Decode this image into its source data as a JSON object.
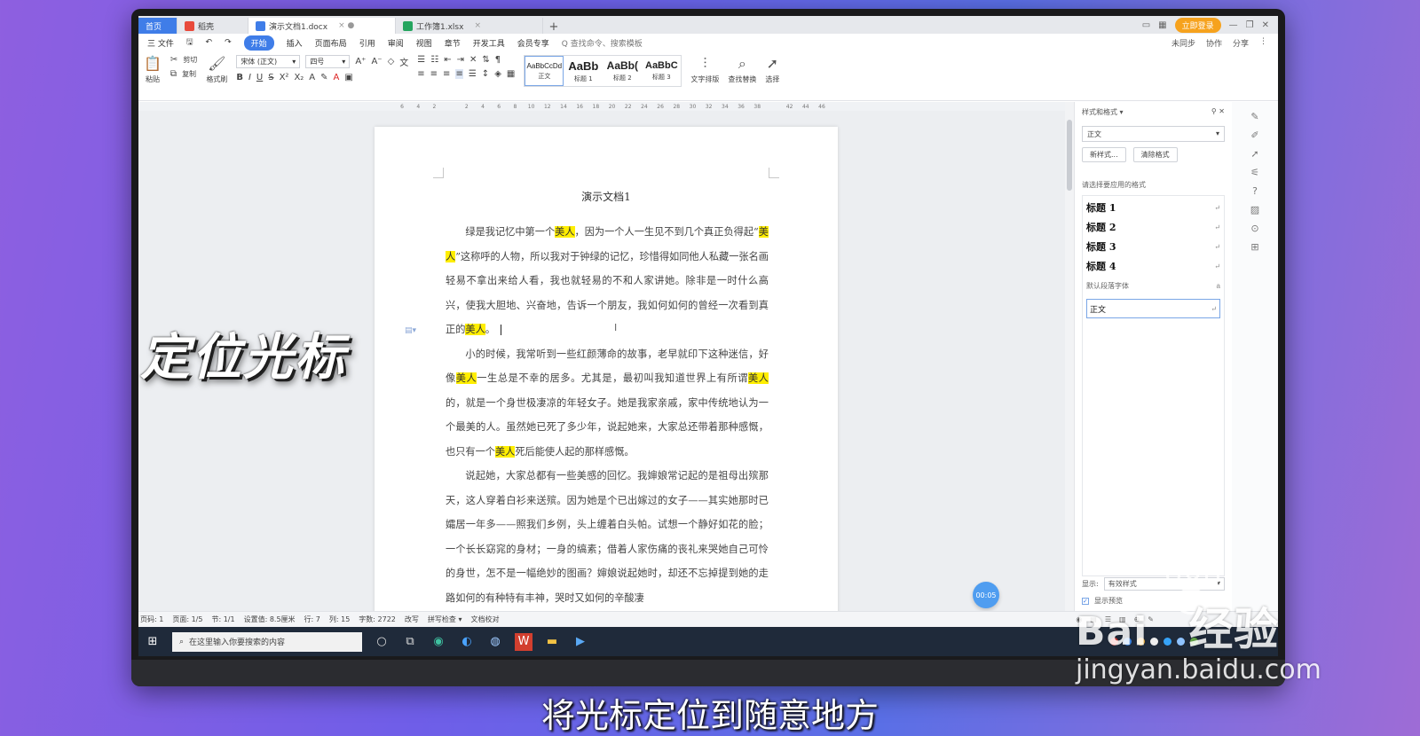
{
  "tabs": {
    "home": "首页",
    "wps_caption": "稻壳",
    "doc": "演示文档1.docx",
    "sheet": "工作簿1.xlsx",
    "login": "立即登录"
  },
  "menu": {
    "file": "三 文件",
    "start": "开始",
    "items": [
      "插入",
      "页面布局",
      "引用",
      "审阅",
      "视图",
      "章节",
      "开发工具",
      "会员专享"
    ],
    "search": "Q 查找命令、搜索模板",
    "sync": "未同步",
    "collab": "协作",
    "share": "分享"
  },
  "ribbon": {
    "paste": "粘贴",
    "cut": "剪切",
    "copy": "复制",
    "format_painter": "格式刷",
    "font": "宋体 (正文)",
    "size": "四号",
    "styles": [
      {
        "preview": "AaBbCcDd",
        "label": "正文"
      },
      {
        "preview": "AaBb",
        "label": "标题 1"
      },
      {
        "preview": "AaBb(",
        "label": "标题 2"
      },
      {
        "preview": "AaBbC",
        "label": "标题 3"
      }
    ],
    "text_layout": "文字排版",
    "find_replace": "查找替换",
    "select": "选择"
  },
  "ruler": [
    "6",
    "4",
    "2",
    "",
    "2",
    "4",
    "6",
    "8",
    "10",
    "12",
    "14",
    "16",
    "18",
    "20",
    "22",
    "24",
    "26",
    "28",
    "30",
    "32",
    "34",
    "36",
    "38",
    "",
    "42",
    "44",
    "46"
  ],
  "document": {
    "title": "演示文档1",
    "paragraphs": [
      [
        {
          "t": "绿是我记忆中第一个"
        },
        {
          "t": "美人",
          "hl": true
        },
        {
          "t": "，因为一个人一生见不到几个真正负得起“"
        },
        {
          "t": "美人",
          "hl": true
        },
        {
          "t": "”这称呼的人物，所以我对于钟绿的记忆，珍惜得如同他人私藏一张名画轻易不拿出来给人看，我也就轻易的不和人家讲她。除非是一时什么高兴，使我大胆地、兴奋地，告诉一个朋友，我如何如何的曾经一次看到真正的"
        },
        {
          "t": "美人",
          "hl": true
        },
        {
          "t": "。"
        }
      ],
      [
        {
          "t": "小的时候，我常听到一些红颜薄命的故事，老早就印下这种迷信，好像"
        },
        {
          "t": "美人",
          "hl": true
        },
        {
          "t": "一生总是不幸的居多。尤其是，最初叫我知道世界上有所谓"
        },
        {
          "t": "美人",
          "hl": true
        },
        {
          "t": "的，就是一个身世极凄凉的年轻女子。她是我家亲戚，家中传统地认为一个最美的人。虽然她已死了多少年，说起她来，大家总还带着那种感慨，也只有一个"
        },
        {
          "t": "美人",
          "hl": true
        },
        {
          "t": "死后能使人起的那样感慨。"
        }
      ],
      [
        {
          "t": "说起她，大家总都有一些美感的回忆。我婶娘常记起的是祖母出殡那天，这人穿着白衫来送殡。因为她是个已出嫁过的女子——其实她那时已孀居一年多——照我们乡例，头上缠着白头帕。试想一个静好如花的脸；一个长长窈窕的身材；一身的缟素；借着人家伤痛的丧礼来哭她自己可怜的身世，怎不是一幅绝妙的图画？婶娘说起她时，却还不忘掉提到她的走路如何的有种特有丰神，哭时又如何的辛酸凄"
        }
      ]
    ]
  },
  "timer": "00:05",
  "pane": {
    "header": "样式和格式 ▾",
    "current_style": "正文",
    "new_style": "新样式...",
    "clear_format": "清除格式",
    "hint": "请选择要应用的格式",
    "styles": [
      "标题  1",
      "标题  2",
      "标题  3",
      "标题  4"
    ],
    "default_font": "默认段落字体",
    "normal": "正文",
    "show_label": "显示:",
    "show_value": "有效样式",
    "preview": "显示预览"
  },
  "status": {
    "items": [
      "页码: 1",
      "页面: 1/5",
      "节: 1/1",
      "设置值: 8.5厘米",
      "行: 7",
      "列: 15",
      "字数: 2722",
      "改写",
      "拼写检查 ▾",
      "文档校对"
    ]
  },
  "taskbar": {
    "search": "在这里输入你要搜索的内容"
  },
  "overlay": {
    "title": "定位光标",
    "subtitle": "将光标定位到随意地方"
  },
  "watermark": {
    "brand": "Bai",
    "brand_cn": "经验",
    "url": "jingyan.baidu.com"
  }
}
